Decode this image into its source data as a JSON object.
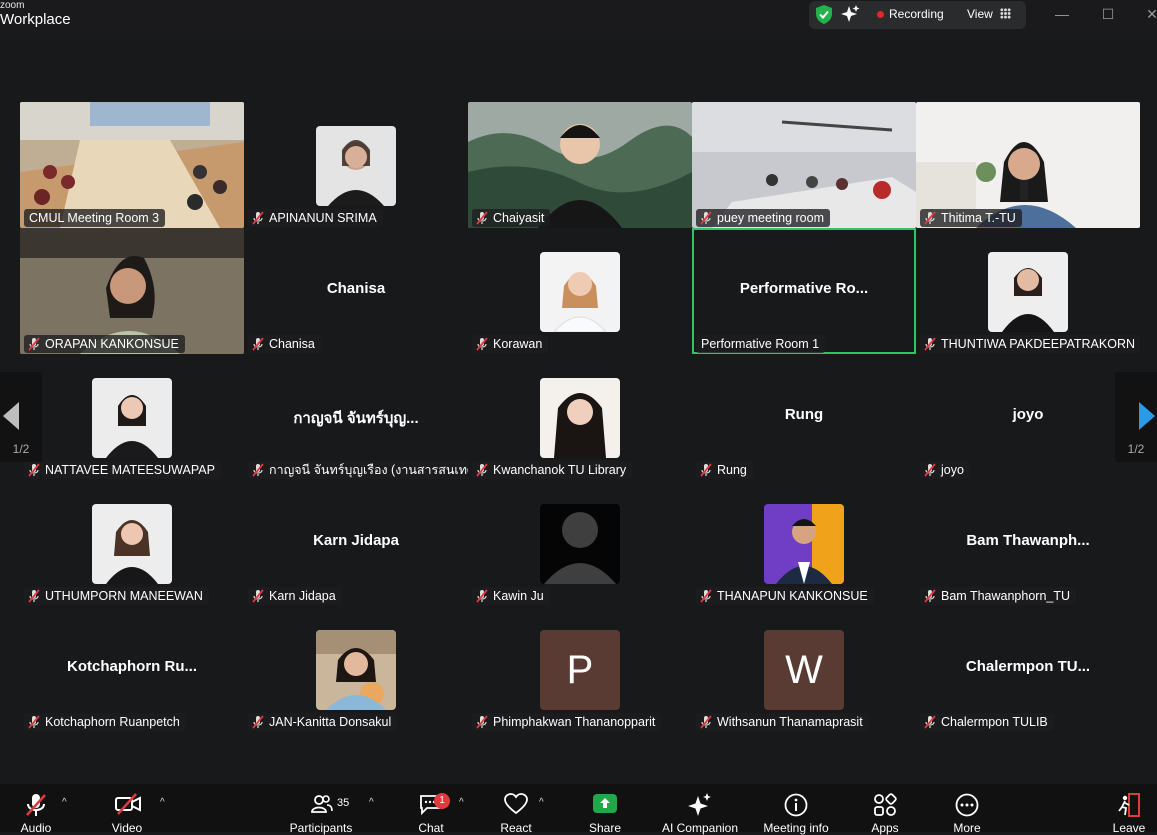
{
  "app": {
    "brand_small": "zoom",
    "brand_big": "Workplace"
  },
  "header": {
    "recording_label": "Recording",
    "view_label": "View",
    "minimize": "—",
    "maximize": "☐",
    "close": "✕"
  },
  "colors": {
    "active_border": "#2fc468",
    "recording_dot": "#e02828",
    "share_green": "#22a84a",
    "avatar_letter_bg": "#5a3b33"
  },
  "pagination": {
    "left": "1/2",
    "right": "1/2"
  },
  "participants": [
    {
      "nameplate": "CMUL Meeting Room 3"
    },
    {
      "nameplate": "APINANUN SRIMA"
    },
    {
      "nameplate": "Chaiyasit"
    },
    {
      "nameplate": "puey meeting room"
    },
    {
      "nameplate": "Thitima T.-TU"
    },
    {
      "nameplate": "ORAPAN KANKONSUE"
    },
    {
      "display": "Chanisa",
      "nameplate": "Chanisa"
    },
    {
      "nameplate": "Korawan"
    },
    {
      "display": "Performative  Ro...",
      "nameplate": "Performative Room 1"
    },
    {
      "nameplate": "THUNTIWA PAKDEEPATRAKORN"
    },
    {
      "nameplate": "NATTAVEE MATEESUWAPAP"
    },
    {
      "display": "กาญจนี จันทร์บุญ...",
      "nameplate": "กาญจนี จันทร์บุญเรือง (งานสารสนเทศ..."
    },
    {
      "nameplate": "Kwanchanok TU Library"
    },
    {
      "display": "Rung",
      "nameplate": "Rung"
    },
    {
      "display": "joyo",
      "nameplate": "joyo"
    },
    {
      "nameplate": "UTHUMPORN MANEEWAN"
    },
    {
      "display": "Karn Jidapa",
      "nameplate": "Karn Jidapa"
    },
    {
      "nameplate": "Kawin Ju"
    },
    {
      "nameplate": "THANAPUN KANKONSUE"
    },
    {
      "display": "Bam  Thawanph...",
      "nameplate": "Bam Thawanphorn_TU"
    },
    {
      "display": "Kotchaphorn  Ru...",
      "nameplate": "Kotchaphorn Ruanpetch"
    },
    {
      "nameplate": "JAN-Kanitta Donsakul"
    },
    {
      "letter": "P",
      "nameplate": "Phimphakwan Thananopparit"
    },
    {
      "letter": "W",
      "nameplate": "Withsanun Thanamaprasit"
    },
    {
      "display": "Chalermpon  TU...",
      "nameplate": "Chalermpon TULIB"
    }
  ],
  "toolbar": {
    "audio": "Audio",
    "video": "Video",
    "participants": "Participants",
    "participants_count": "35",
    "chat": "Chat",
    "chat_badge": "1",
    "react": "React",
    "share": "Share",
    "ai_companion": "AI Companion",
    "meeting_info": "Meeting info",
    "apps": "Apps",
    "more": "More",
    "leave": "Leave"
  }
}
